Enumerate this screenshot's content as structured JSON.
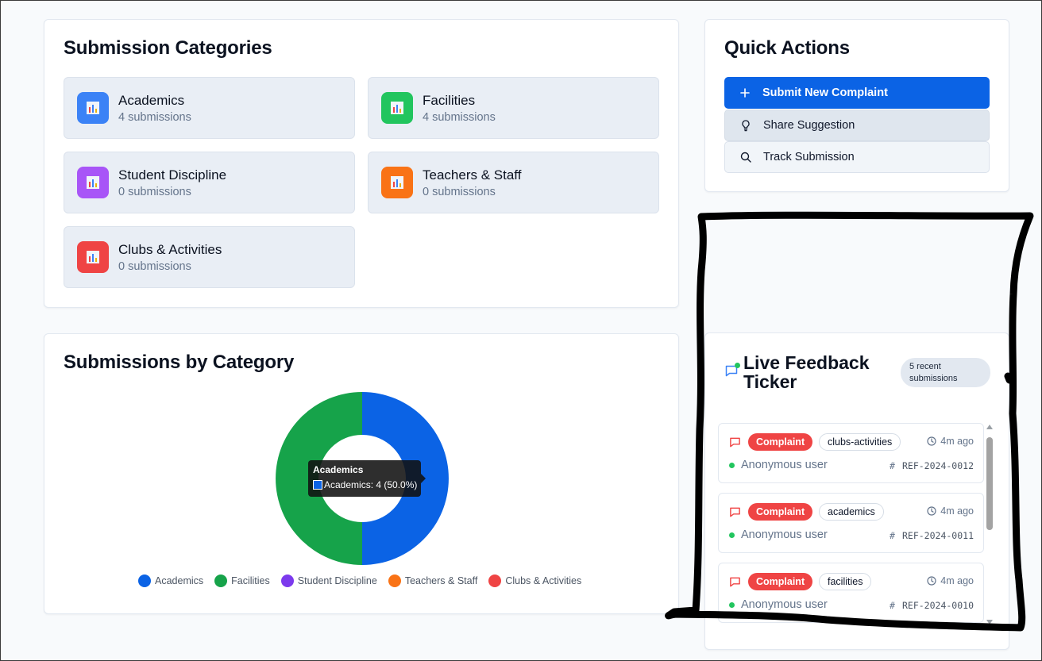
{
  "categories": {
    "title": "Submission Categories",
    "items": [
      {
        "name": "Academics",
        "count": "4 submissions",
        "color": "#3b82f6"
      },
      {
        "name": "Facilities",
        "count": "4 submissions",
        "color": "#22c55e"
      },
      {
        "name": "Student Discipline",
        "count": "0 submissions",
        "color": "#a855f7"
      },
      {
        "name": "Teachers & Staff",
        "count": "0 submissions",
        "color": "#f97316"
      },
      {
        "name": "Clubs & Activities",
        "count": "0 submissions",
        "color": "#ef4444"
      }
    ]
  },
  "quick_actions": {
    "title": "Quick Actions",
    "submit_label": "Submit New Complaint",
    "suggest_label": "Share Suggestion",
    "track_label": "Track Submission"
  },
  "chart": {
    "title": "Submissions by Category",
    "tooltip_title": "Academics",
    "tooltip_text": "Academics: 4 (50.0%)"
  },
  "chart_data": {
    "type": "pie",
    "categories": [
      "Academics",
      "Facilities",
      "Student Discipline",
      "Teachers & Staff",
      "Clubs & Activities"
    ],
    "values": [
      4,
      4,
      0,
      0,
      0
    ],
    "colors": [
      "#0b63e5",
      "#16a34a",
      "#7c3aed",
      "#f97316",
      "#ef4444"
    ],
    "legend_position": "bottom"
  },
  "ticker": {
    "title": "Live Feedback Ticker",
    "badge": "5 recent submissions",
    "items": [
      {
        "type": "Complaint",
        "category": "clubs-activities",
        "time": "4m ago",
        "user": "Anonymous user",
        "ref": "REF-2024-0012"
      },
      {
        "type": "Complaint",
        "category": "academics",
        "time": "4m ago",
        "user": "Anonymous user",
        "ref": "REF-2024-0011"
      },
      {
        "type": "Complaint",
        "category": "facilities",
        "time": "4m ago",
        "user": "Anonymous user",
        "ref": "REF-2024-0010"
      }
    ]
  }
}
